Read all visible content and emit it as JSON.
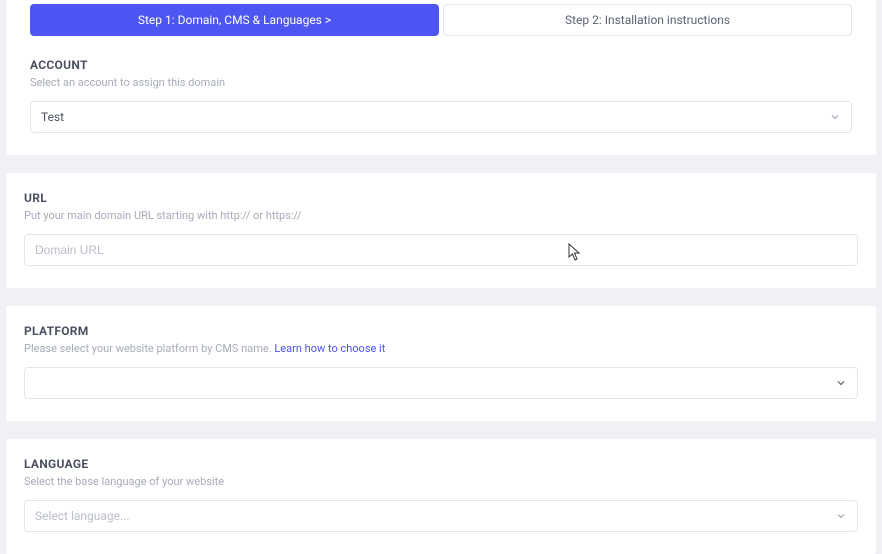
{
  "tabs": {
    "step1": "Step 1: Domain, CMS & Languages  >",
    "step2": "Step 2: Installation instructions"
  },
  "account": {
    "title": "ACCOUNT",
    "subtitle": "Select an account to assign this domain",
    "value": "Test"
  },
  "url": {
    "title": "URL",
    "subtitle": "Put your main domain URL starting with http:// or https://",
    "placeholder": "Domain URL"
  },
  "platform": {
    "title": "PLATFORM",
    "subtitlePrefix": "Please select your website platform by CMS name.  ",
    "learnLink": "Learn how to choose it",
    "value": ""
  },
  "language": {
    "title": "LANGUAGE",
    "subtitle": "Select the base language of your website",
    "placeholder": "Select language..."
  }
}
